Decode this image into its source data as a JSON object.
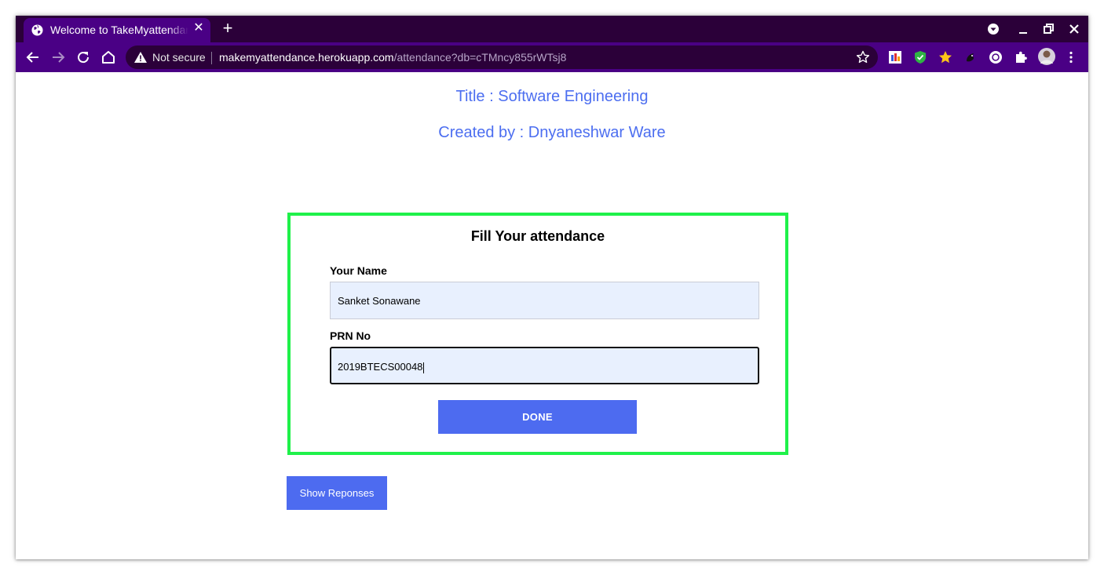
{
  "browser": {
    "tab_title": "Welcome to TakeMyattendance",
    "tab_close_icon": "close-icon",
    "new_tab_icon": "plus-icon",
    "security_label": "Not secure",
    "url_host": "makemyattendance.herokuapp.com",
    "url_path": "/attendance?db=cTMncy855rWTsj8",
    "window_controls": [
      "profile-menu-icon",
      "minimize-icon",
      "restore-icon",
      "close-icon"
    ],
    "toolbar_icons": [
      "back-arrow-icon",
      "forward-arrow-icon",
      "reload-icon",
      "home-icon"
    ],
    "extension_icons": [
      "ext-color-bars-icon",
      "ext-shield-check-icon",
      "ext-star-icon",
      "ext-bird-icon",
      "ext-circle-icon",
      "puzzle-icon",
      "avatar",
      "kebab-menu-icon"
    ],
    "colors": {
      "tabstrip": "#2b0039",
      "toolbar": "#4a0085",
      "omnibox": "#2b0039"
    }
  },
  "page": {
    "title_line": "Title : Software Engineering",
    "creator_line": "Created by : Dnyaneshwar Ware",
    "form": {
      "heading": "Fill Your attendance",
      "name_label": "Your Name",
      "name_value": "Sanket Sonawane",
      "prn_label": "PRN No",
      "prn_value": "2019BTECS00048",
      "submit_label": "DONE"
    },
    "show_responses_label": "Show Reponses",
    "colors": {
      "accent": "#4d6bf0",
      "heading_text": "#4c6ef0",
      "card_border": "#1ff14a",
      "input_bg": "#e8f0fe"
    }
  }
}
